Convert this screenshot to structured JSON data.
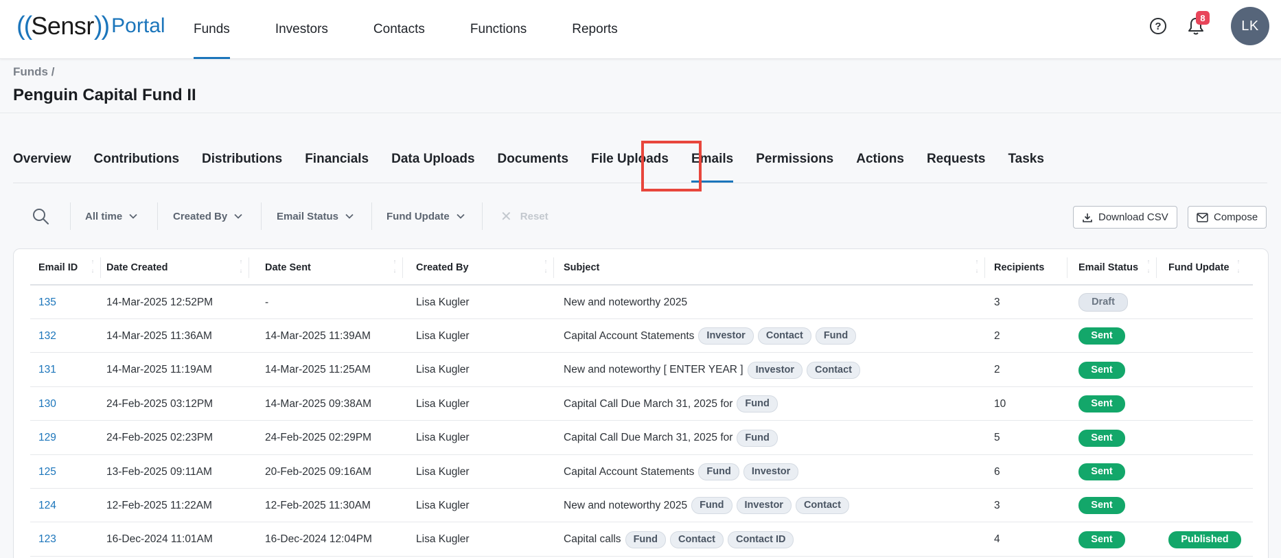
{
  "header": {
    "logo": {
      "paren_open": "((",
      "brand": "Sensr",
      "paren_close": "))",
      "portal": "Portal"
    },
    "nav": [
      "Funds",
      "Investors",
      "Contacts",
      "Functions",
      "Reports"
    ],
    "active_nav": "Funds",
    "help_icon": "?",
    "notification_count": "8",
    "avatar_initials": "LK"
  },
  "breadcrumb": "Funds /",
  "page_title": "Penguin Capital Fund II",
  "tabs": [
    "Overview",
    "Contributions",
    "Distributions",
    "Financials",
    "Data Uploads",
    "Documents",
    "File Uploads",
    "Emails",
    "Permissions",
    "Actions",
    "Requests",
    "Tasks"
  ],
  "active_tab": "Emails",
  "filters": {
    "time": "All time",
    "created_by": "Created By",
    "email_status": "Email Status",
    "fund_update": "Fund Update",
    "reset": "Reset"
  },
  "buttons": {
    "download_csv": "Download CSV",
    "compose": "Compose"
  },
  "table": {
    "columns": [
      "Email ID",
      "Date Created",
      "Date Sent",
      "Created By",
      "Subject",
      "Recipients",
      "Email Status",
      "Fund Update"
    ],
    "rows": [
      {
        "id": "135",
        "created": "14-Mar-2025 12:52PM",
        "sent": "-",
        "by": "Lisa Kugler",
        "subject": "New and noteworthy 2025",
        "tags": [],
        "recipients": "3",
        "status": "Draft",
        "fund_update": ""
      },
      {
        "id": "132",
        "created": "14-Mar-2025 11:36AM",
        "sent": "14-Mar-2025 11:39AM",
        "by": "Lisa Kugler",
        "subject": "Capital Account Statements",
        "tags": [
          "Investor",
          "Contact",
          "Fund"
        ],
        "recipients": "2",
        "status": "Sent",
        "fund_update": ""
      },
      {
        "id": "131",
        "created": "14-Mar-2025 11:19AM",
        "sent": "14-Mar-2025 11:25AM",
        "by": "Lisa Kugler",
        "subject": "New and noteworthy [ ENTER YEAR ]",
        "tags": [
          "Investor",
          "Contact"
        ],
        "recipients": "2",
        "status": "Sent",
        "fund_update": ""
      },
      {
        "id": "130",
        "created": "24-Feb-2025 03:12PM",
        "sent": "14-Mar-2025 09:38AM",
        "by": "Lisa Kugler",
        "subject": "Capital Call Due March 31, 2025 for",
        "tags": [
          "Fund"
        ],
        "recipients": "10",
        "status": "Sent",
        "fund_update": ""
      },
      {
        "id": "129",
        "created": "24-Feb-2025 02:23PM",
        "sent": "24-Feb-2025 02:29PM",
        "by": "Lisa Kugler",
        "subject": "Capital Call Due March 31, 2025 for",
        "tags": [
          "Fund"
        ],
        "recipients": "5",
        "status": "Sent",
        "fund_update": ""
      },
      {
        "id": "125",
        "created": "13-Feb-2025 09:11AM",
        "sent": "20-Feb-2025 09:16AM",
        "by": "Lisa Kugler",
        "subject": "Capital Account Statements",
        "tags": [
          "Fund",
          "Investor"
        ],
        "recipients": "6",
        "status": "Sent",
        "fund_update": ""
      },
      {
        "id": "124",
        "created": "12-Feb-2025 11:22AM",
        "sent": "12-Feb-2025 11:30AM",
        "by": "Lisa Kugler",
        "subject": "New and noteworthy 2025",
        "tags": [
          "Fund",
          "Investor",
          "Contact"
        ],
        "recipients": "3",
        "status": "Sent",
        "fund_update": ""
      },
      {
        "id": "123",
        "created": "16-Dec-2024 11:01AM",
        "sent": "16-Dec-2024 12:04PM",
        "by": "Lisa Kugler",
        "subject": "Capital calls",
        "tags": [
          "Fund",
          "Contact",
          "Contact ID"
        ],
        "recipients": "4",
        "status": "Sent",
        "fund_update": "Published"
      }
    ]
  },
  "colors": {
    "accent": "#1b75bb",
    "sent": "#13a76a",
    "highlight": "#e8463c",
    "badge": "#e8455a"
  }
}
